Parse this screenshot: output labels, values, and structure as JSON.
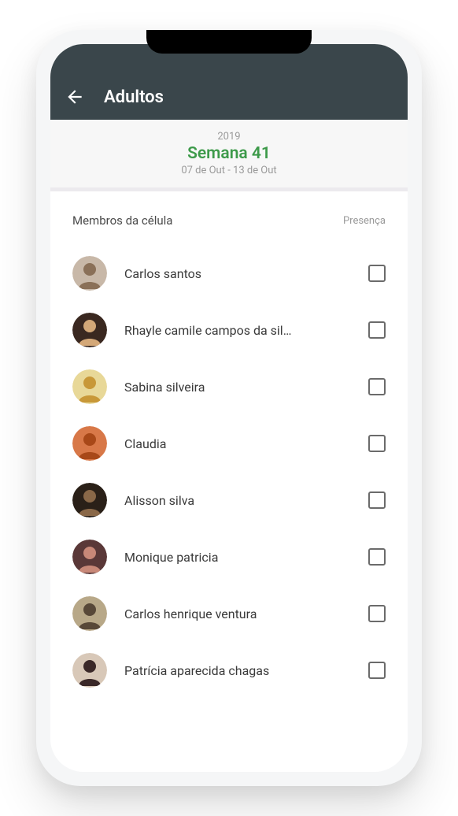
{
  "header": {
    "title": "Adultos"
  },
  "week": {
    "year": "2019",
    "label": "Semana 41",
    "range": "07 de Out - 13 de Out"
  },
  "list": {
    "header_left": "Membros da célula",
    "header_right": "Presença",
    "members": [
      {
        "name": "Carlos santos"
      },
      {
        "name": "Rhayle camile campos da sil…"
      },
      {
        "name": "Sabina silveira"
      },
      {
        "name": "Claudia"
      },
      {
        "name": "Alisson silva"
      },
      {
        "name": "Monique patricia"
      },
      {
        "name": "Carlos henrique ventura"
      },
      {
        "name": "Patrícia aparecida chagas"
      }
    ]
  },
  "avatar_colors": [
    {
      "bg": "#c8b8a8",
      "fg": "#8a7058"
    },
    {
      "bg": "#3a2820",
      "fg": "#d4a878"
    },
    {
      "bg": "#e8d898",
      "fg": "#c89838"
    },
    {
      "bg": "#d87848",
      "fg": "#a84818"
    },
    {
      "bg": "#2a2018",
      "fg": "#8a6848"
    },
    {
      "bg": "#5a3838",
      "fg": "#c88878"
    },
    {
      "bg": "#b8a888",
      "fg": "#584838"
    },
    {
      "bg": "#d8c8b8",
      "fg": "#3a2828"
    }
  ]
}
